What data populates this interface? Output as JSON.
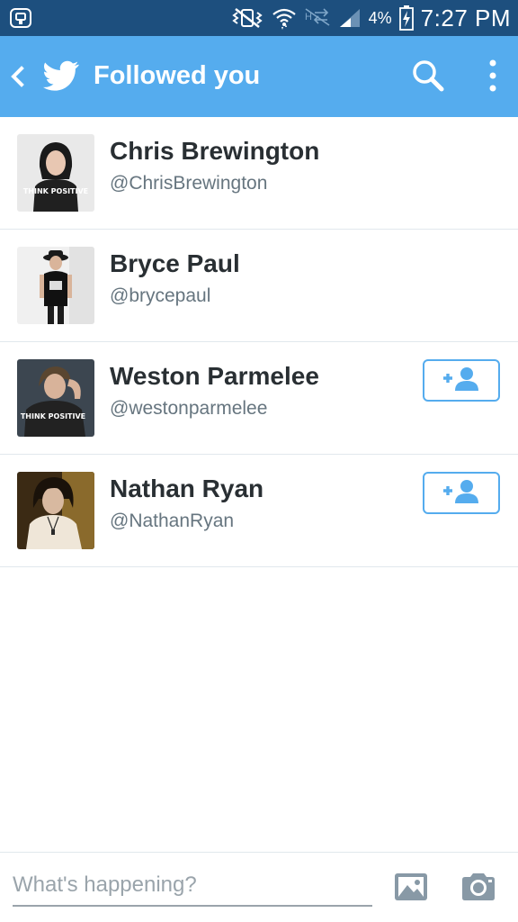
{
  "status_bar": {
    "battery_percent": "4%",
    "time": "7:27 PM",
    "left_icon": "keyboard-notification-icon",
    "icons": [
      "vibrate-mute-icon",
      "wifi-icon",
      "data-off-icon",
      "signal-icon",
      "battery-charging-icon"
    ]
  },
  "app_bar": {
    "title": "Followed you",
    "background": "#55acee",
    "icons": [
      "back-icon",
      "twitter-bird-icon",
      "search-icon",
      "overflow-menu-icon"
    ]
  },
  "users": [
    {
      "name": "Chris Brewington",
      "handle": "@ChrisBrewington",
      "follow_button": false,
      "avatar_shirt_text": "THINK POSITIVE"
    },
    {
      "name": "Bryce Paul",
      "handle": "@brycepaul",
      "follow_button": false
    },
    {
      "name": "Weston Parmelee",
      "handle": "@westonparmelee",
      "follow_button": true,
      "avatar_shirt_text": "THINK POSITIVE"
    },
    {
      "name": "Nathan Ryan",
      "handle": "@NathanRyan",
      "follow_button": true
    }
  ],
  "follow_button_icon": "add-user-icon",
  "composer": {
    "placeholder": "What's happening?",
    "icons": [
      "image-icon",
      "camera-icon"
    ]
  }
}
